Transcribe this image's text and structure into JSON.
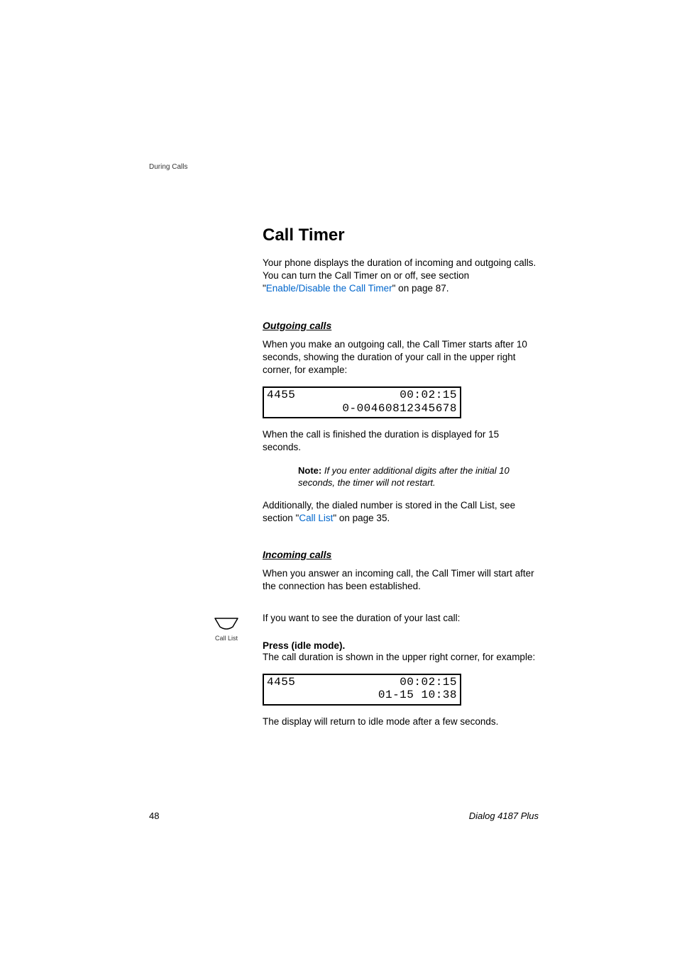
{
  "header": {
    "section": "During Calls"
  },
  "section": {
    "title": "Call Timer",
    "intro_part1": "Your phone displays the duration of incoming and outgoing calls. You can turn the Call Timer on or off, see section \"",
    "intro_link": "Enable/Disable the Call Timer",
    "intro_part2": "\" on page 87."
  },
  "outgoing": {
    "title": "Outgoing calls",
    "para1": "When you make an outgoing call, the Call Timer starts after 10 seconds, showing the duration of your call in the upper right corner, for example:",
    "display": {
      "row1_left": "4455",
      "row1_right": "00:02:15",
      "row2": "0-00460812345678"
    },
    "para2": "When the call is finished the duration is displayed for 15 seconds.",
    "note_label": "Note: ",
    "note_text": "If you enter additional digits after the initial 10 seconds, the timer will not restart.",
    "para3_part1": "Additionally, the dialed number is stored in the Call List, see section \"",
    "para3_link": "Call List",
    "para3_part2": "\" on page 35."
  },
  "incoming": {
    "title": "Incoming calls",
    "para1": "When you answer an incoming call, the Call Timer will start after the connection has been established.",
    "para2": "If you want to see the duration of your last call:",
    "icon_caption": "Call List",
    "instruction": "Press (idle mode).",
    "para3": "The call duration is shown in the upper right corner, for example:",
    "display": {
      "row1_left": "4455",
      "row1_right": "00:02:15",
      "row2": "01-15 10:38"
    },
    "para4": "The display will return to idle mode after a few seconds."
  },
  "footer": {
    "page": "48",
    "product": "Dialog 4187 Plus"
  }
}
